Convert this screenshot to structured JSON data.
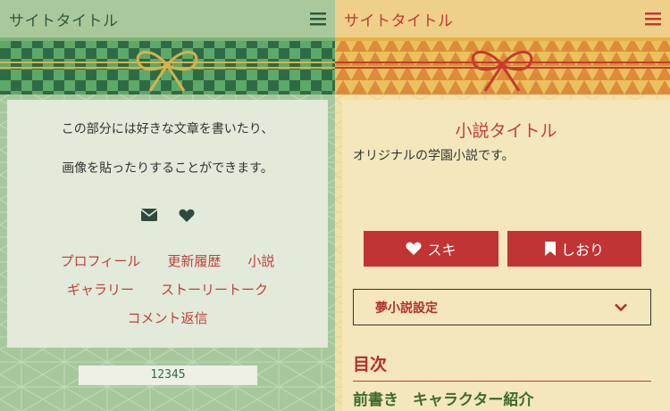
{
  "left": {
    "header": {
      "site_title": "サイトタイトル",
      "menu_icon": "hamburger-menu-icon"
    },
    "intro_lines": [
      "この部分には好きな文章を書いたり、",
      "画像を貼ったりすることができます。"
    ],
    "icons": [
      "envelope-icon",
      "heart-icon"
    ],
    "nav_row1": [
      "プロフィール",
      "更新履歴",
      "小説"
    ],
    "nav_row2": [
      "ギャラリー",
      "ストーリートーク"
    ],
    "nav_row3": [
      "コメント返信"
    ],
    "counter": "12345",
    "colors": {
      "header_bg": "#a9c99d",
      "accent": "#2f5a3a",
      "link": "#c0403a"
    }
  },
  "right": {
    "header": {
      "site_title": "サイトタイトル",
      "menu_icon": "hamburger-menu-icon"
    },
    "novel_title": "小説タイトル",
    "novel_description": "オリジナルの学園小説です。",
    "like_button": {
      "label": "スキ",
      "icon": "heart-icon"
    },
    "bookmark_button": {
      "label": "しおり",
      "icon": "bookmark-icon"
    },
    "dream_settings": {
      "label": "夢小説設定",
      "icon": "chevron-down-icon"
    },
    "toc": {
      "heading": "目次",
      "items": [
        "前書き",
        "キャラクター紹介"
      ]
    },
    "colors": {
      "header_bg": "#efd08a",
      "accent": "#c03533",
      "toc_link": "#3d6b2a"
    }
  }
}
